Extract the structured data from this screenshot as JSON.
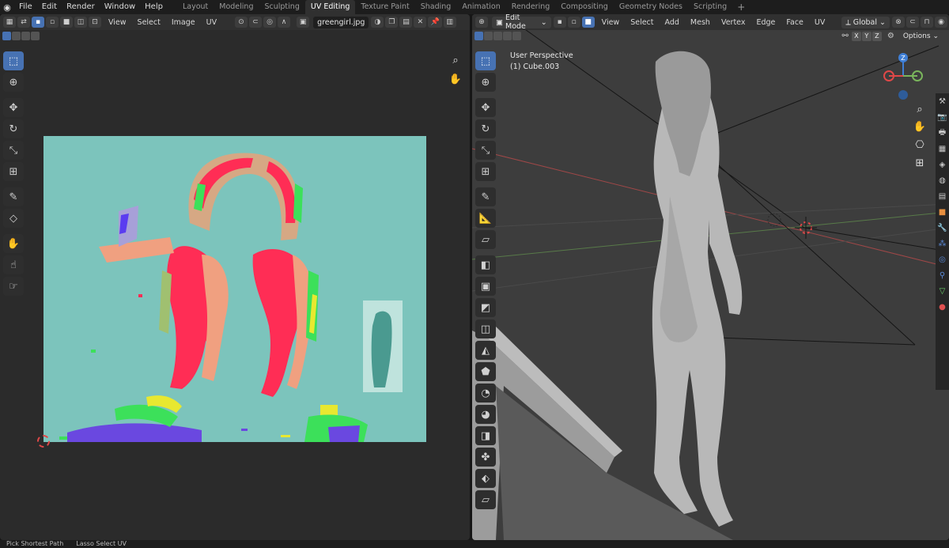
{
  "topbar": {
    "menus": [
      "File",
      "Edit",
      "Render",
      "Window",
      "Help"
    ],
    "workspaces": [
      "Layout",
      "Modeling",
      "Sculpting",
      "UV Editing",
      "Texture Paint",
      "Shading",
      "Animation",
      "Rendering",
      "Compositing",
      "Geometry Nodes",
      "Scripting"
    ],
    "active_workspace": "UV Editing",
    "add_label": "+"
  },
  "uv_editor": {
    "menus": [
      "View",
      "Select",
      "Image",
      "UV"
    ],
    "image_name": "greengirl.jpg",
    "image_bg_color": "#7cc4bc"
  },
  "view3d": {
    "mode": "Edit Mode",
    "menus": [
      "View",
      "Select",
      "Add",
      "Mesh",
      "Vertex",
      "Edge",
      "Face",
      "UV"
    ],
    "transform_orientation": "Global",
    "options_label": "Options",
    "axis_buttons": [
      "X",
      "Y",
      "Z"
    ],
    "perspective_label": "User Perspective",
    "object_label": "(1) Cube.003",
    "gizmo_z": "Z"
  },
  "statusbar": {
    "items": [
      "Pick Shortest Path",
      "Lasso Select UV"
    ]
  },
  "colors": {
    "accent": "#4772b3",
    "axis_x": "#e04848",
    "axis_y": "#7ab55c",
    "axis_z": "#3f7fd6"
  }
}
